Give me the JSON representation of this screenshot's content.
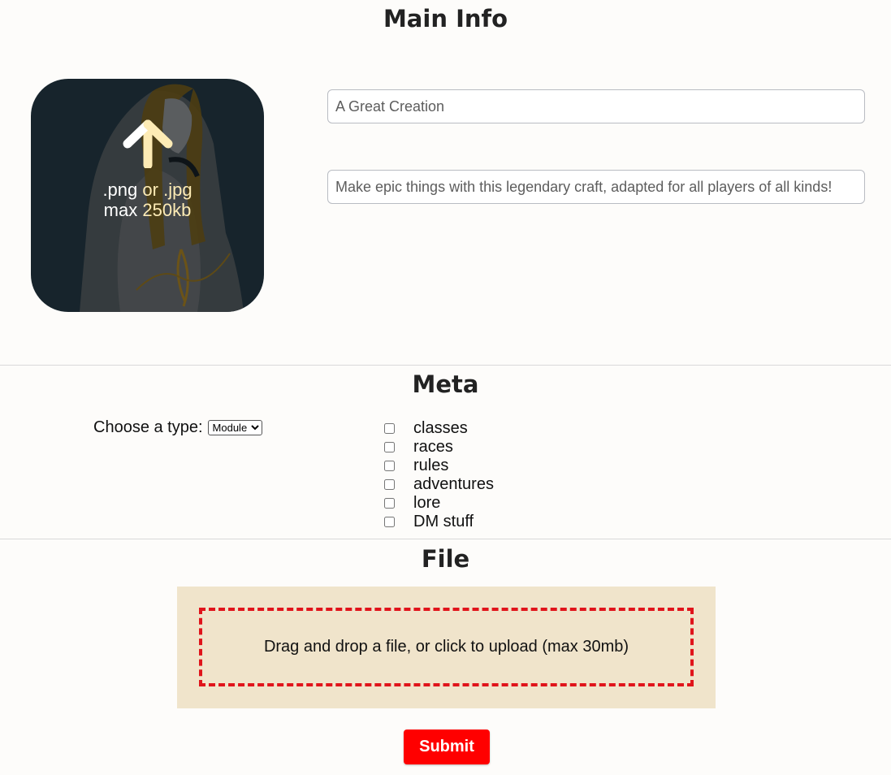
{
  "main_info": {
    "title": "Main Info",
    "image_upload": {
      "hint_format_a": ".png",
      "hint_format_or": "or",
      "hint_format_b": ".jpg",
      "hint_size_prefix": "max",
      "hint_size_value": "250kb",
      "icon": "upload-arrow-icon"
    },
    "name_input": {
      "placeholder": "A Great Creation",
      "value": ""
    },
    "description_input": {
      "placeholder": "Make epic things with this legendary craft, adapted for all players of all kinds!",
      "value": ""
    }
  },
  "meta": {
    "title": "Meta",
    "type_label": "Choose a type:",
    "type_selected": "Module",
    "type_options": [
      "Module"
    ],
    "tags": [
      {
        "label": "classes",
        "checked": false
      },
      {
        "label": "races",
        "checked": false
      },
      {
        "label": "rules",
        "checked": false
      },
      {
        "label": "adventures",
        "checked": false
      },
      {
        "label": "lore",
        "checked": false
      },
      {
        "label": "DM stuff",
        "checked": false
      }
    ]
  },
  "file": {
    "title": "File",
    "dropzone_text": "Drag and drop a file, or click to upload (max 30mb)"
  },
  "submit_label": "Submit",
  "colors": {
    "background": "#fdfcfa",
    "dropzone_panel": "#f0e4cb",
    "dropzone_border": "#e0141b",
    "submit": "#ff0000",
    "image_tile": "#17242c",
    "hint_accent": "#fdebb5"
  }
}
